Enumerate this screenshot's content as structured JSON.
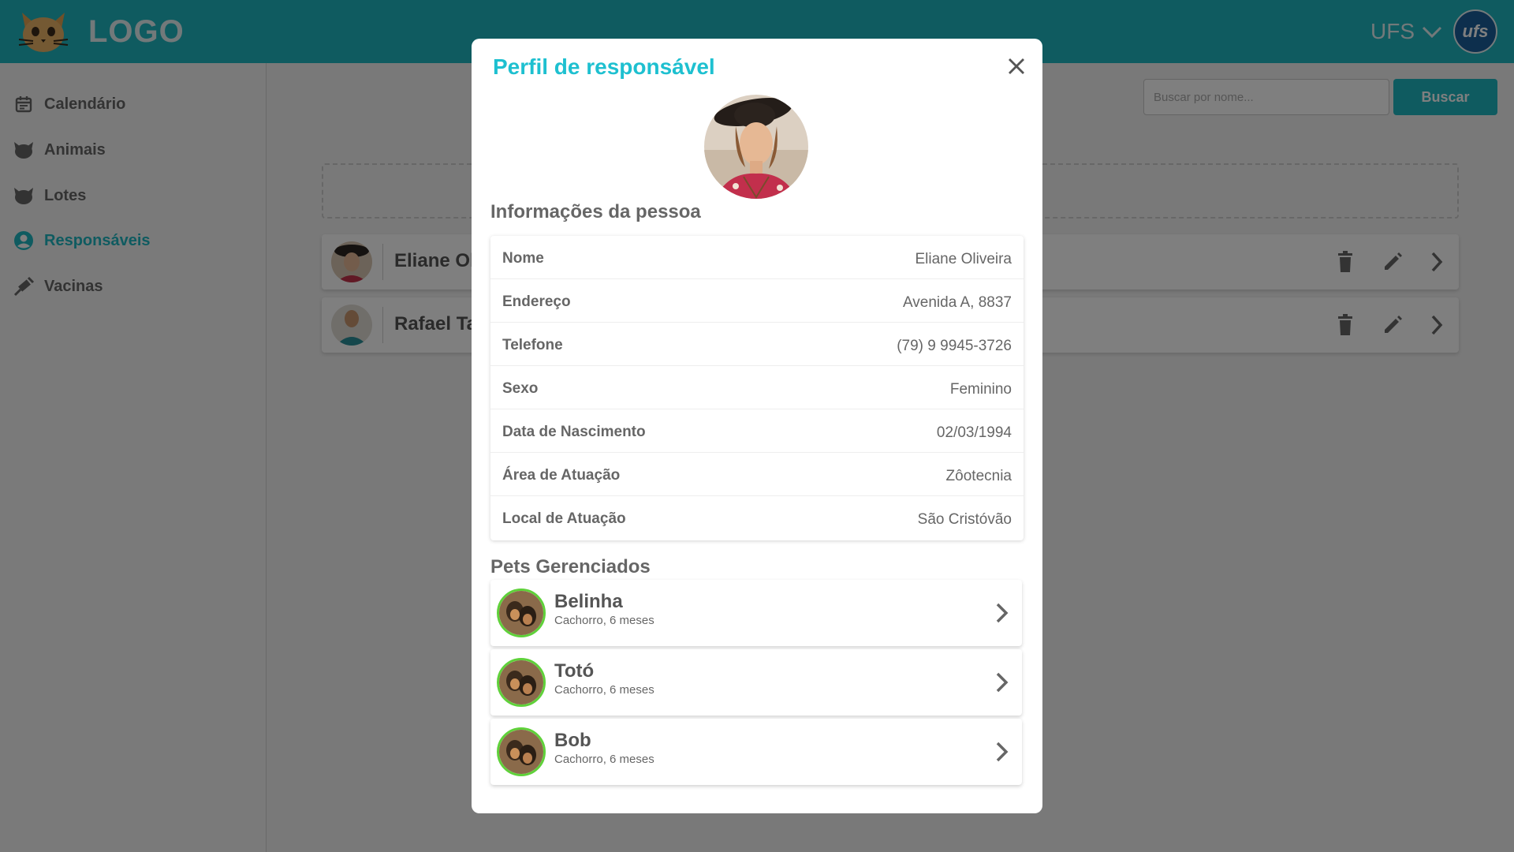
{
  "header": {
    "logo_text": "LOGO",
    "org_label": "UFS",
    "org_avatar_text": "ufs"
  },
  "sidebar": {
    "items": [
      {
        "label": "Calendário",
        "icon": "calendar-icon"
      },
      {
        "label": "Animais",
        "icon": "cat-icon"
      },
      {
        "label": "Lotes",
        "icon": "cat-icon"
      },
      {
        "label": "Responsáveis",
        "icon": "account-circle-icon",
        "active": true
      },
      {
        "label": "Vacinas",
        "icon": "syringe-icon"
      }
    ]
  },
  "search": {
    "placeholder": "Buscar por nome...",
    "button_label": "Buscar"
  },
  "list": {
    "rows": [
      {
        "name": "Eliane Oliveira"
      },
      {
        "name": "Rafael Tavares"
      }
    ]
  },
  "modal": {
    "title": "Perfil de responsável",
    "info_heading": "Informações da pessoa",
    "info": [
      {
        "label": "Nome",
        "value": "Eliane Oliveira"
      },
      {
        "label": "Endereço",
        "value": "Avenida A, 8837"
      },
      {
        "label": "Telefone",
        "value": "(79) 9 9945-3726"
      },
      {
        "label": "Sexo",
        "value": "Feminino"
      },
      {
        "label": "Data de Nascimento",
        "value": "02/03/1994"
      },
      {
        "label": "Área de Atuação",
        "value": "Zôotecnia"
      },
      {
        "label": "Local de Atuação",
        "value": "São Cristóvão"
      }
    ],
    "pets_heading": "Pets Gerenciados",
    "pets": [
      {
        "name": "Belinha",
        "desc": "Cachorro, 6 meses"
      },
      {
        "name": "Totó",
        "desc": "Cachorro, 6 meses"
      },
      {
        "name": "Bob",
        "desc": "Cachorro, 6 meses"
      }
    ]
  },
  "colors": {
    "brand": "#1eb6c0",
    "title_accent": "#1ec0d0",
    "pet_ring": "#5fd13a"
  }
}
